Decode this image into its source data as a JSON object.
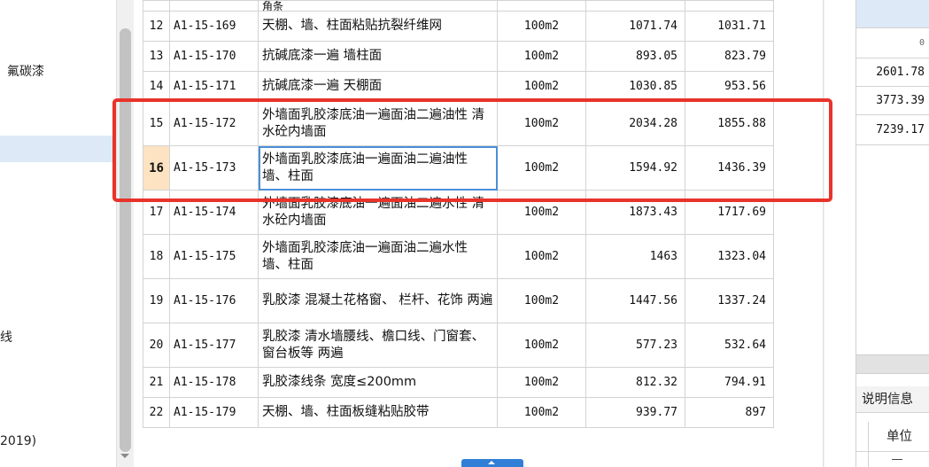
{
  "left_panel": {
    "items": [
      {
        "label": "氟碳漆",
        "top": 0
      },
      {
        "label": "线",
        "top": 0
      },
      {
        "label": "2019)",
        "top": 0
      }
    ]
  },
  "table": {
    "top_partial_name": "角条",
    "rows": [
      {
        "no": "12",
        "code": "A1-15-169",
        "name": "天棚、墙、柱面粘贴抗裂纤维网",
        "unit": "100m2",
        "price1": "1071.74",
        "price2": "1031.71"
      },
      {
        "no": "13",
        "code": "A1-15-170",
        "name": "抗碱底漆一遍 墙柱面",
        "unit": "100m2",
        "price1": "893.05",
        "price2": "823.79"
      },
      {
        "no": "14",
        "code": "A1-15-171",
        "name": "抗碱底漆一遍 天棚面",
        "unit": "100m2",
        "price1": "1030.85",
        "price2": "953.56"
      },
      {
        "no": "15",
        "code": "A1-15-172",
        "name": "外墙面乳胶漆底油一遍面油二遍油性 清水砼内墙面",
        "unit": "100m2",
        "price1": "2034.28",
        "price2": "1855.88"
      },
      {
        "no": "16",
        "code": "A1-15-173",
        "name": "外墙面乳胶漆底油一遍面油二遍油性 墙、柱面",
        "unit": "100m2",
        "price1": "1594.92",
        "price2": "1436.39"
      },
      {
        "no": "17",
        "code": "A1-15-174",
        "name": "外墙面乳胶漆底油一遍面油二遍水性 清水砼内墙面",
        "unit": "100m2",
        "price1": "1873.43",
        "price2": "1717.69"
      },
      {
        "no": "18",
        "code": "A1-15-175",
        "name": "外墙面乳胶漆底油一遍面油二遍水性 墙、柱面",
        "unit": "100m2",
        "price1": "1463",
        "price2": "1323.04"
      },
      {
        "no": "19",
        "code": "A1-15-176",
        "name": "乳胶漆 混凝土花格窗、 栏杆、花饰 两遍",
        "unit": "100m2",
        "price1": "1447.56",
        "price2": "1337.24"
      },
      {
        "no": "20",
        "code": "A1-15-177",
        "name": "乳胶漆 清水墙腰线、檐口线、门窗套、窗台板等 两遍",
        "unit": "100m2",
        "price1": "577.23",
        "price2": "532.64"
      },
      {
        "no": "21",
        "code": "A1-15-178",
        "name": "乳胶漆线条 宽度≤200mm",
        "unit": "100m2",
        "price1": "812.32",
        "price2": "794.91"
      },
      {
        "no": "22",
        "code": "A1-15-179",
        "name": "天棚、墙、柱面板缝粘贴胶带",
        "unit": "100m2",
        "price1": "939.77",
        "price2": "897"
      }
    ],
    "active_row_no": "16"
  },
  "right_panel": {
    "top_value": "0",
    "values": [
      "2601.78",
      "3773.39",
      "7239.17"
    ],
    "info_title": "说明信息",
    "unit_header": "单位"
  },
  "colors": {
    "highlight_red": "#e8332a",
    "selection_blue": "#4b8fd8",
    "active_row_orange": "#fde3c2",
    "tab_blue": "#2f7fd7"
  }
}
